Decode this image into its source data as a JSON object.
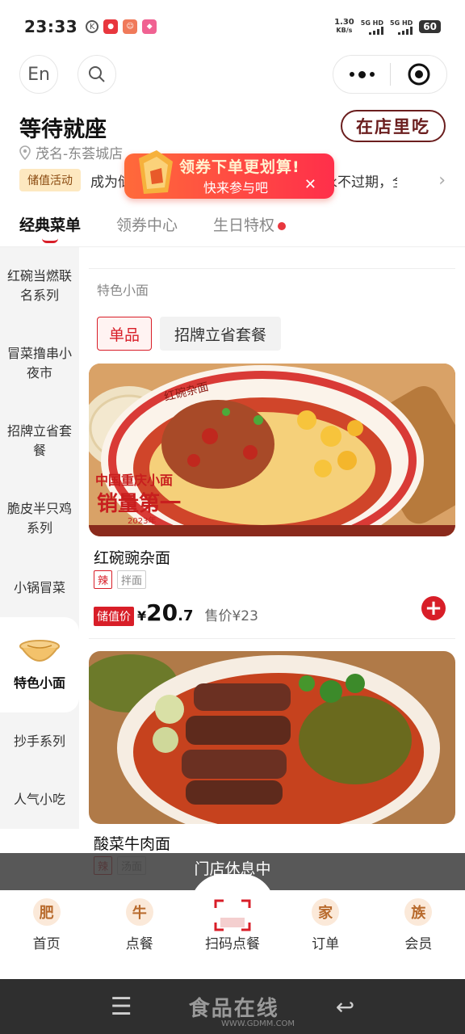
{
  "status_bar": {
    "time": "23:33",
    "net_speed": "1.30",
    "net_unit": "KB/s",
    "sig1": "5G HD",
    "sig2": "5G HD",
    "battery": "60"
  },
  "top": {
    "lang_label": "En"
  },
  "store": {
    "name": "等待就座",
    "address": "茂名-东荟城店",
    "dine_label": "在店里吃"
  },
  "promo": {
    "tag": "储值活动",
    "text": "成为储值会员享受优惠折扣，储值金额永不过期，全国…"
  },
  "coupon_popup": {
    "title": "领券下单更划算!",
    "subtitle": "快来参与吧"
  },
  "tabs": [
    {
      "label": "经典菜单"
    },
    {
      "label": "领券中心"
    },
    {
      "label": "生日特权"
    }
  ],
  "sidebar": {
    "items": [
      {
        "label": "红碗当燃联名系列"
      },
      {
        "label": "冒菜撸串小夜市"
      },
      {
        "label": "招牌立省套餐"
      },
      {
        "label": "脆皮半只鸡系列"
      },
      {
        "label": "小锅冒菜"
      },
      {
        "label": "特色小面"
      },
      {
        "label": "抄手系列"
      },
      {
        "label": "人气小吃"
      }
    ]
  },
  "section": {
    "title": "特色小面",
    "chips": [
      {
        "label": "单品"
      },
      {
        "label": "招牌立省套餐"
      }
    ]
  },
  "products": [
    {
      "name": "红碗豌杂面",
      "bowl_text": "红碗杂面",
      "badge_line1": "中国重庆小面",
      "badge_line2": "销量第一",
      "badge_year": "2023年",
      "tags": [
        "辣",
        "拌面"
      ],
      "stored_label": "储值价",
      "currency": "¥",
      "price_int": "20",
      "price_dec": ".7",
      "sale_label": "售价¥23"
    },
    {
      "name": "酸菜牛肉面",
      "tags": [
        "辣",
        "汤面"
      ]
    }
  ],
  "closed_banner": "门店休息中",
  "bottom_nav": [
    {
      "badge": "肥",
      "label": "首页"
    },
    {
      "badge": "牛",
      "label": "点餐"
    },
    {
      "badge": "",
      "label": "扫码点餐"
    },
    {
      "badge": "家",
      "label": "订单"
    },
    {
      "badge": "族",
      "label": "会员"
    }
  ],
  "system_nav": {
    "watermark": "食品在线",
    "url": "WWW.GDMM.COM"
  },
  "colors": {
    "accent_red": "#d81e28",
    "coupon_gradient": [
      "#ff6a3a",
      "#ff2f4a"
    ],
    "dine_brown": "#6b1e1e"
  }
}
